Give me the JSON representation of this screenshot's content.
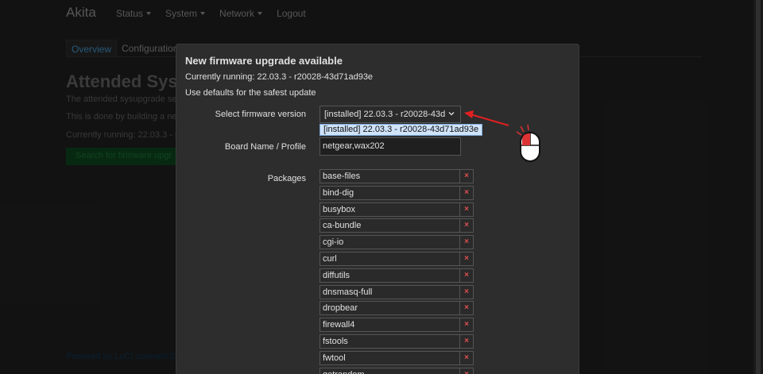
{
  "navbar": {
    "brand": "Akita",
    "menu": [
      {
        "label": "Status",
        "dropdown": true
      },
      {
        "label": "System",
        "dropdown": true
      },
      {
        "label": "Network",
        "dropdown": true
      },
      {
        "label": "Logout",
        "dropdown": false
      }
    ]
  },
  "tabs": [
    {
      "label": "Overview",
      "active": true
    },
    {
      "label": "Configuration",
      "active": false
    }
  ],
  "background": {
    "title": "Attended Sysu",
    "line1": "The attended sysupgrade se",
    "line2": "This is done by building a ne",
    "line3": "Currently running: 22.03.3 - r",
    "search_button": "Search for firmware upgr",
    "footer": "Powered by LuCI openwrt-22.0"
  },
  "modal": {
    "title": "New firmware upgrade available",
    "running": "Currently running: 22.03.3 - r20028-43d71ad93e",
    "defaults_note": "Use defaults for the safest update",
    "firmware_label": "Select firmware version",
    "firmware_selected": "[installed] 22.03.3 - r20028-43d",
    "firmware_option": "[installed] 22.03.3 - r20028-43d71ad93e",
    "board_label": "Board Name / Profile",
    "board_value": "netgear,wax202",
    "packages_label": "Packages",
    "remove_symbol": "×",
    "packages": [
      "base-files",
      "bind-dig",
      "busybox",
      "ca-bundle",
      "cgi-io",
      "curl",
      "diffutils",
      "dnsmasq-full",
      "dropbear",
      "firewall4",
      "fstools",
      "fwtool",
      "getrandom"
    ]
  },
  "colors": {
    "accent": "#4aa3df",
    "arrow": "#e02020",
    "remove": "#e05050"
  }
}
